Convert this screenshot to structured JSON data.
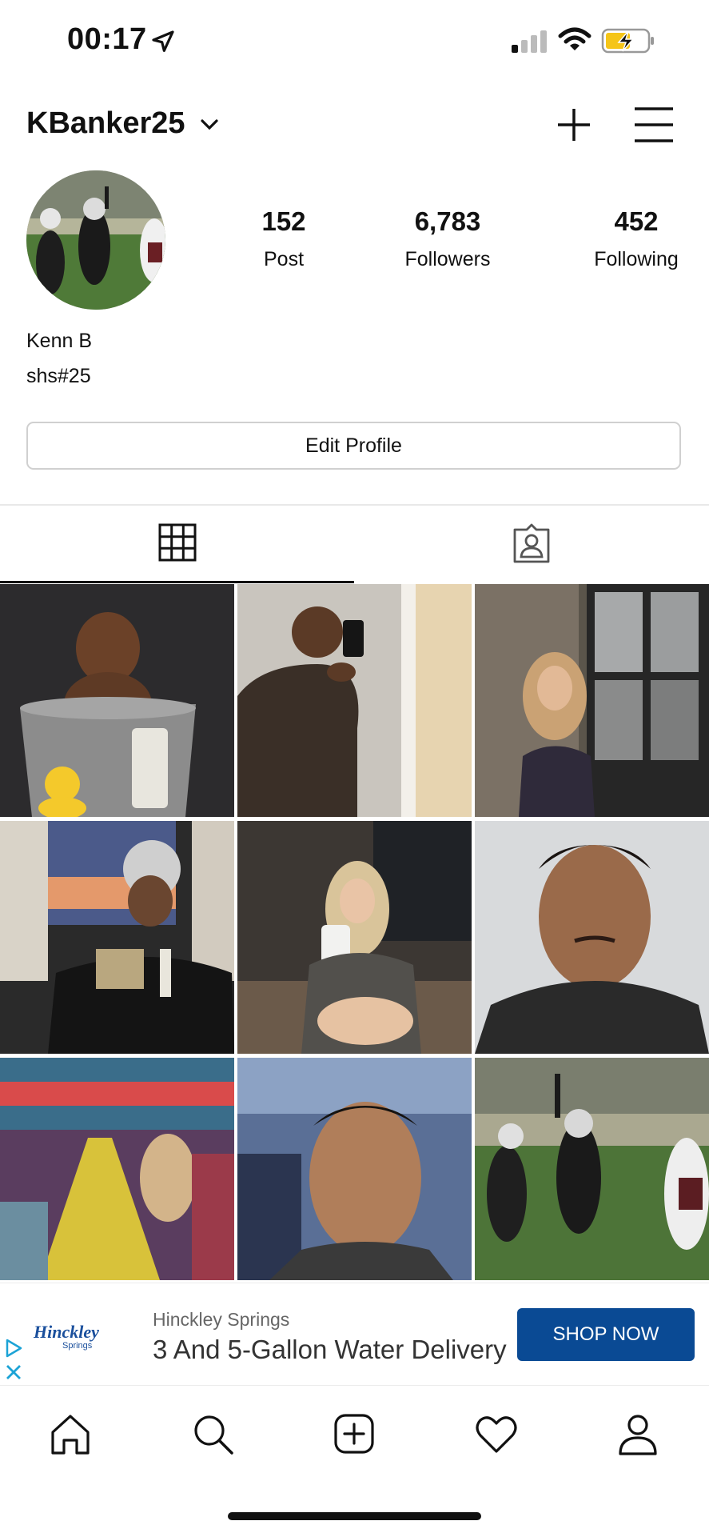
{
  "status_bar": {
    "time": "00:17",
    "icons": [
      "location-arrow-icon",
      "cellular-signal-icon",
      "wifi-icon",
      "battery-charging-icon"
    ],
    "battery_color": "#f5c518"
  },
  "header": {
    "username": "KBanker25",
    "icons": [
      "chevron-down-icon",
      "plus-icon",
      "menu-icon"
    ]
  },
  "profile": {
    "stats": [
      {
        "value": "152",
        "label": "Post"
      },
      {
        "value": "6,783",
        "label": "Followers"
      },
      {
        "value": "452",
        "label": "Following"
      }
    ],
    "display_name": "Kenn B",
    "bio": "shs#25",
    "edit_button": "Edit Profile"
  },
  "tabs": {
    "items": [
      "grid-icon",
      "tagged-user-icon"
    ],
    "active": 0
  },
  "ad": {
    "logo": "Hinckley",
    "logo_sub": "Springs",
    "brand": "Hinckley Springs",
    "title": "3 And 5-Gallon Water Delivery",
    "cta": "SHOP NOW",
    "cta_color": "#0a4a94",
    "icons": [
      "adchoices-play-icon",
      "close-icon"
    ]
  },
  "bottom_nav": {
    "items": [
      "home-icon",
      "search-icon",
      "new-post-icon",
      "heart-icon",
      "profile-icon"
    ]
  },
  "colors": {
    "text": "#111111",
    "border": "#d0d0d0",
    "ad_blue": "#0a4a94",
    "adchoices": "#1ca3d6"
  }
}
